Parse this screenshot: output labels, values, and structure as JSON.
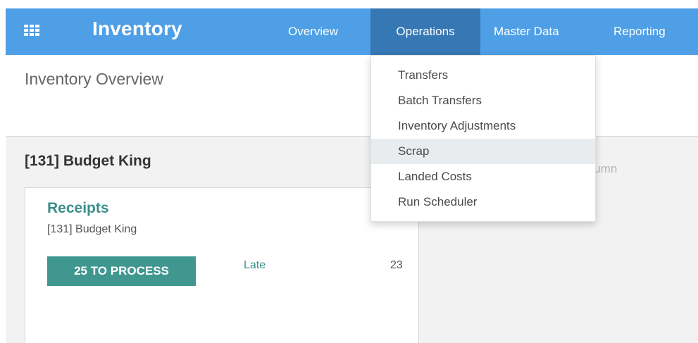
{
  "navbar": {
    "app_title": "Inventory",
    "menu": [
      {
        "label": "Overview"
      },
      {
        "label": "Operations"
      },
      {
        "label": "Master Data"
      },
      {
        "label": "Reporting"
      }
    ]
  },
  "operations_menu": {
    "items": [
      {
        "label": "Transfers"
      },
      {
        "label": "Batch Transfers"
      },
      {
        "label": "Inventory Adjustments"
      },
      {
        "label": "Scrap"
      },
      {
        "label": "Landed Costs"
      },
      {
        "label": "Run Scheduler"
      }
    ],
    "highlighted": "Scrap"
  },
  "control_panel": {
    "title": "Inventory Overview"
  },
  "kanban": {
    "group_title": "[131] Budget King",
    "add_column_partial": "olumn",
    "card": {
      "title": "Receipts",
      "subtitle": "[131] Budget King",
      "process_button": "25 TO PROCESS",
      "late_label": "Late",
      "late_count": "23"
    }
  },
  "colors": {
    "navbar": "#4e9fe6",
    "navbar_active": "#3678b3",
    "accent_teal": "#3f978f",
    "menu_highlight": "#e8ecef"
  },
  "icons": {
    "apps": "grid-apps-icon"
  }
}
